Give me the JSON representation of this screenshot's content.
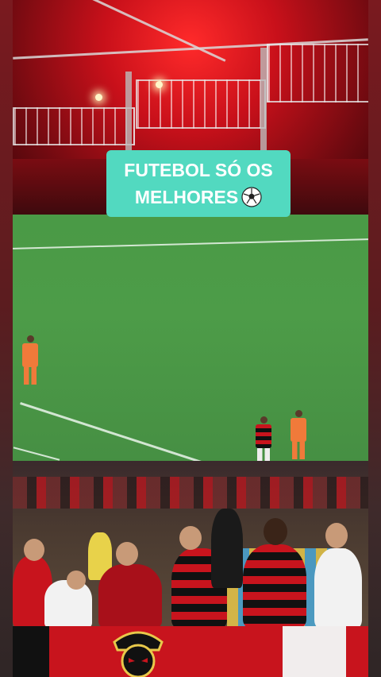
{
  "caption": {
    "line1": "FUTEBOL SÓ OS",
    "line2": "MELHORES",
    "icon": "soccer-ball-icon"
  },
  "colors": {
    "caption_background": "#52d9c0",
    "caption_text": "#ffffff",
    "pitch": "#4a9a46",
    "stadium_red": "#c8101a"
  }
}
